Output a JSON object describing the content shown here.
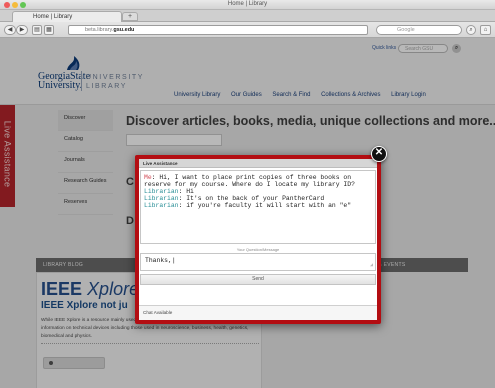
{
  "browser": {
    "window_title": "Home | Library",
    "tab_title": "Home | Library",
    "new_tab_symbol": "+",
    "url_prefix": "beta.library.",
    "url_domain": "gsu.edu",
    "search_engine_placeholder": "Google",
    "traffic_colors": [
      "#ef5b5b",
      "#f5bc3b",
      "#63c655"
    ]
  },
  "site": {
    "logo_text_line1": "GeorgiaState",
    "logo_text_line2": "University.",
    "logo_library_line1": "UNIVERSITY",
    "logo_library_line2": "LIBRARY",
    "quick_links": "Quick links",
    "quick_search_placeholder": "Search GSU",
    "top_nav": [
      "University Library",
      "Our Guides",
      "Search & Find",
      "Collections & Archives",
      "Library Login"
    ],
    "live_assistance": "Live Assistance",
    "left_nav": [
      "Discover",
      "Catalog",
      "Journals",
      "Research Guides",
      "Reserves"
    ],
    "discover_heading": "Discover articles, books, media, unique collections and more...",
    "partial_heading_c": "C",
    "partial_heading_d": "D",
    "library_blog_label": "LIBRARY BLOG",
    "events_label": "S & EVENTS",
    "blog": {
      "logo_main": "IEEE",
      "logo_italic": "Xplore",
      "logo_sub": "DIGITAL LIB",
      "title": "IEEE Xplore not ju",
      "text_lines": [
        "While IEEE Xplore is a resource mainly used by Computer Science, it is also a great resource for",
        "information on technical devices including those used in neuroscience, business, health, genetics,",
        "biomedical and physics."
      ]
    }
  },
  "chat": {
    "header": "Live Assistance",
    "transcript": [
      {
        "speaker": "Me",
        "text": "Hi, I want to place print copies of three books on"
      },
      {
        "speaker": "",
        "text": "reserve for my course.  Where do I locate my library ID?"
      },
      {
        "speaker": "Librarian",
        "text": "Hi"
      },
      {
        "speaker": "Librarian",
        "text": "It's on the back of your PantherCard"
      },
      {
        "speaker": "Librarian",
        "text": "if you're faculty it will start with an \"e\""
      }
    ],
    "message_label": "Your Question/Message",
    "message_value": "Thanks,|",
    "send_label": "Send",
    "status": "Chat Available",
    "close_symbol": "✕",
    "border_color": "#b30d12"
  }
}
